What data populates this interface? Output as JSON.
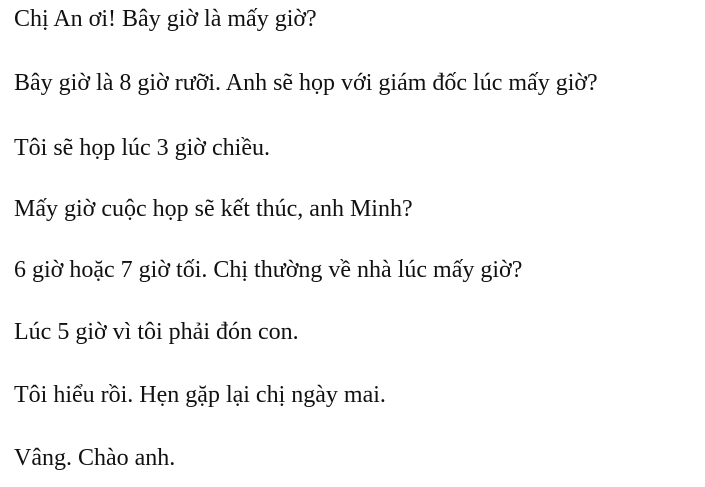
{
  "document": {
    "lines": [
      "Chị An ơi! Bây giờ là mấy giờ?",
      "Bây giờ là 8 giờ rưỡi. Anh sẽ họp với giám đốc lúc mấy giờ?",
      "Tôi sẽ họp lúc 3 giờ chiều.",
      "Mấy giờ cuộc họp sẽ kết thúc, anh Minh?",
      "6 giờ hoặc 7 giờ tối. Chị thường về nhà lúc mấy giờ?",
      "Lúc 5 giờ vì tôi phải đón con.",
      "Tôi hiểu rồi. Hẹn gặp lại chị ngày mai.",
      "Vâng. Chào anh."
    ]
  }
}
